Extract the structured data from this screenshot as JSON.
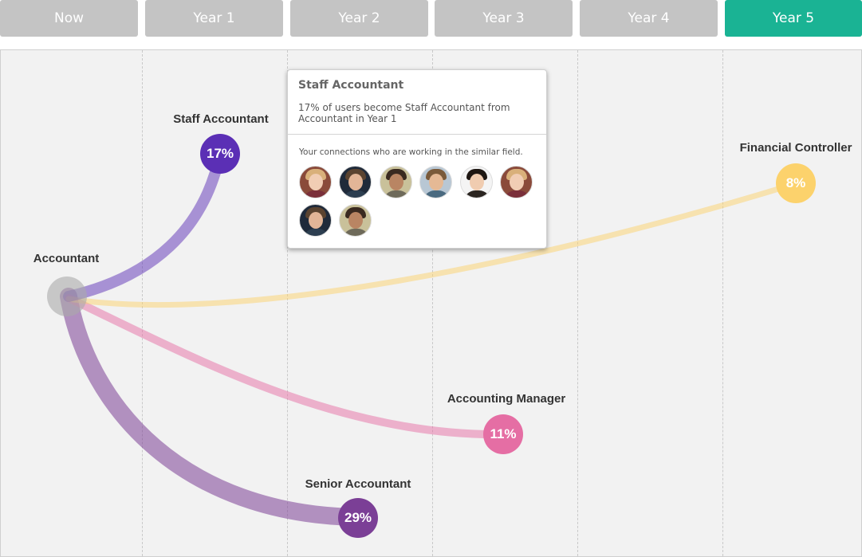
{
  "tabs": [
    {
      "label": "Now",
      "active": false
    },
    {
      "label": "Year 1",
      "active": false
    },
    {
      "label": "Year 2",
      "active": false
    },
    {
      "label": "Year 3",
      "active": false
    },
    {
      "label": "Year 4",
      "active": false
    },
    {
      "label": "Year 5",
      "active": true
    }
  ],
  "colors": {
    "tab_default": "#c4c4c4",
    "tab_active": "#1ab394",
    "staff": "#5b2fb5",
    "senior": "#7b3f96",
    "manager": "#e56ea4",
    "controller": "#fcd26c"
  },
  "origin": {
    "label": "Accountant"
  },
  "nodes": [
    {
      "id": "staff",
      "label": "Staff Accountant",
      "percent": "17%"
    },
    {
      "id": "controller",
      "label": "Financial Controller",
      "percent": "8%"
    },
    {
      "id": "manager",
      "label": "Accounting Manager",
      "percent": "11%"
    },
    {
      "id": "senior",
      "label": "Senior Accountant",
      "percent": "29%"
    }
  ],
  "tooltip": {
    "title": "Staff Accountant",
    "description": "17% of users become Staff Accountant from Accountant in Year 1",
    "connections_label": "Your connections who are working in the similar field.",
    "avatars": [
      "avatar-1",
      "avatar-2",
      "avatar-3",
      "avatar-4",
      "avatar-5",
      "avatar-6",
      "avatar-7",
      "avatar-8"
    ]
  }
}
